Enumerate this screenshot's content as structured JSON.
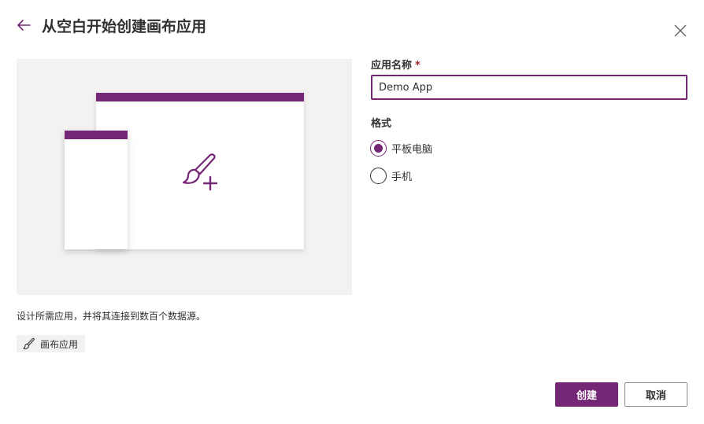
{
  "header": {
    "title": "从空白开始创建画布应用",
    "back_icon": "arrow-left-icon",
    "close_icon": "close-icon"
  },
  "preview": {
    "description": "设计所需应用，并将其连接到数百个数据源。",
    "tag_label": "画布应用",
    "tag_icon": "brush-icon"
  },
  "form": {
    "app_name_label": "应用名称",
    "required_mark": "*",
    "app_name_value": "Demo App",
    "format_label": "格式",
    "format_options": [
      {
        "label": "平板电脑",
        "selected": true
      },
      {
        "label": "手机",
        "selected": false
      }
    ]
  },
  "footer": {
    "create_label": "创建",
    "cancel_label": "取消"
  },
  "colors": {
    "accent": "#742774",
    "preview_bg": "#f3f2f1",
    "required": "#a4262c"
  }
}
